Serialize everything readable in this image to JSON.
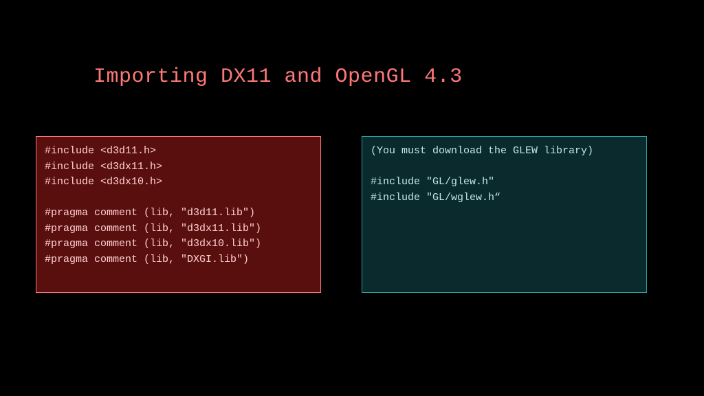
{
  "slide": {
    "title": "Importing DX11 and OpenGL 4.3",
    "left_box": "#include <d3d11.h>\n#include <d3dx11.h>\n#include <d3dx10.h>\n\n#pragma comment (lib, \"d3d11.lib\")\n#pragma comment (lib, \"d3dx11.lib\")\n#pragma comment (lib, \"d3dx10.lib\")\n#pragma comment (lib, \"DXGI.lib\")",
    "right_box": "(You must download the GLEW library)\n\n#include \"GL/glew.h\"\n#include \"GL/wglew.h“"
  }
}
